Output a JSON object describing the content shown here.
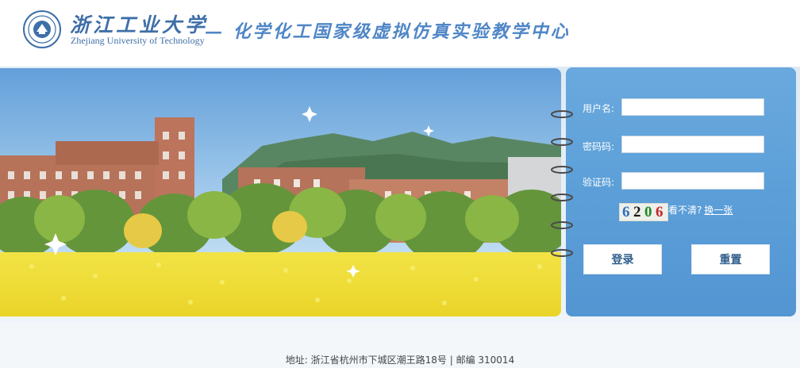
{
  "header": {
    "university_cn": "浙江工业大学",
    "university_en": "Zhejiang University of Technology",
    "center_title": "— 化学化工国家级虚拟仿真实验教学中心",
    "logo_icon": "university-seal-icon"
  },
  "login": {
    "username_label": "用户名:",
    "password_label": "密码码:",
    "captcha_label": "验证码:",
    "username_value": "",
    "password_value": "",
    "captcha_value": "",
    "captcha_code": [
      "6",
      "2",
      "0",
      "6"
    ],
    "captcha_colors": [
      "#2f6fc0",
      "#1a1a1a",
      "#1f8a2a",
      "#c82828"
    ],
    "captcha_hint": "看不清?",
    "captcha_refresh": "换一张",
    "login_button": "登录",
    "reset_button": "重置"
  },
  "footer": {
    "address": "地址: 浙江省杭州市下城区潮王路18号 | 邮编 310014"
  },
  "colors": {
    "brand_blue": "#3e6fa8",
    "panel_blue": "#5c9fd8"
  }
}
